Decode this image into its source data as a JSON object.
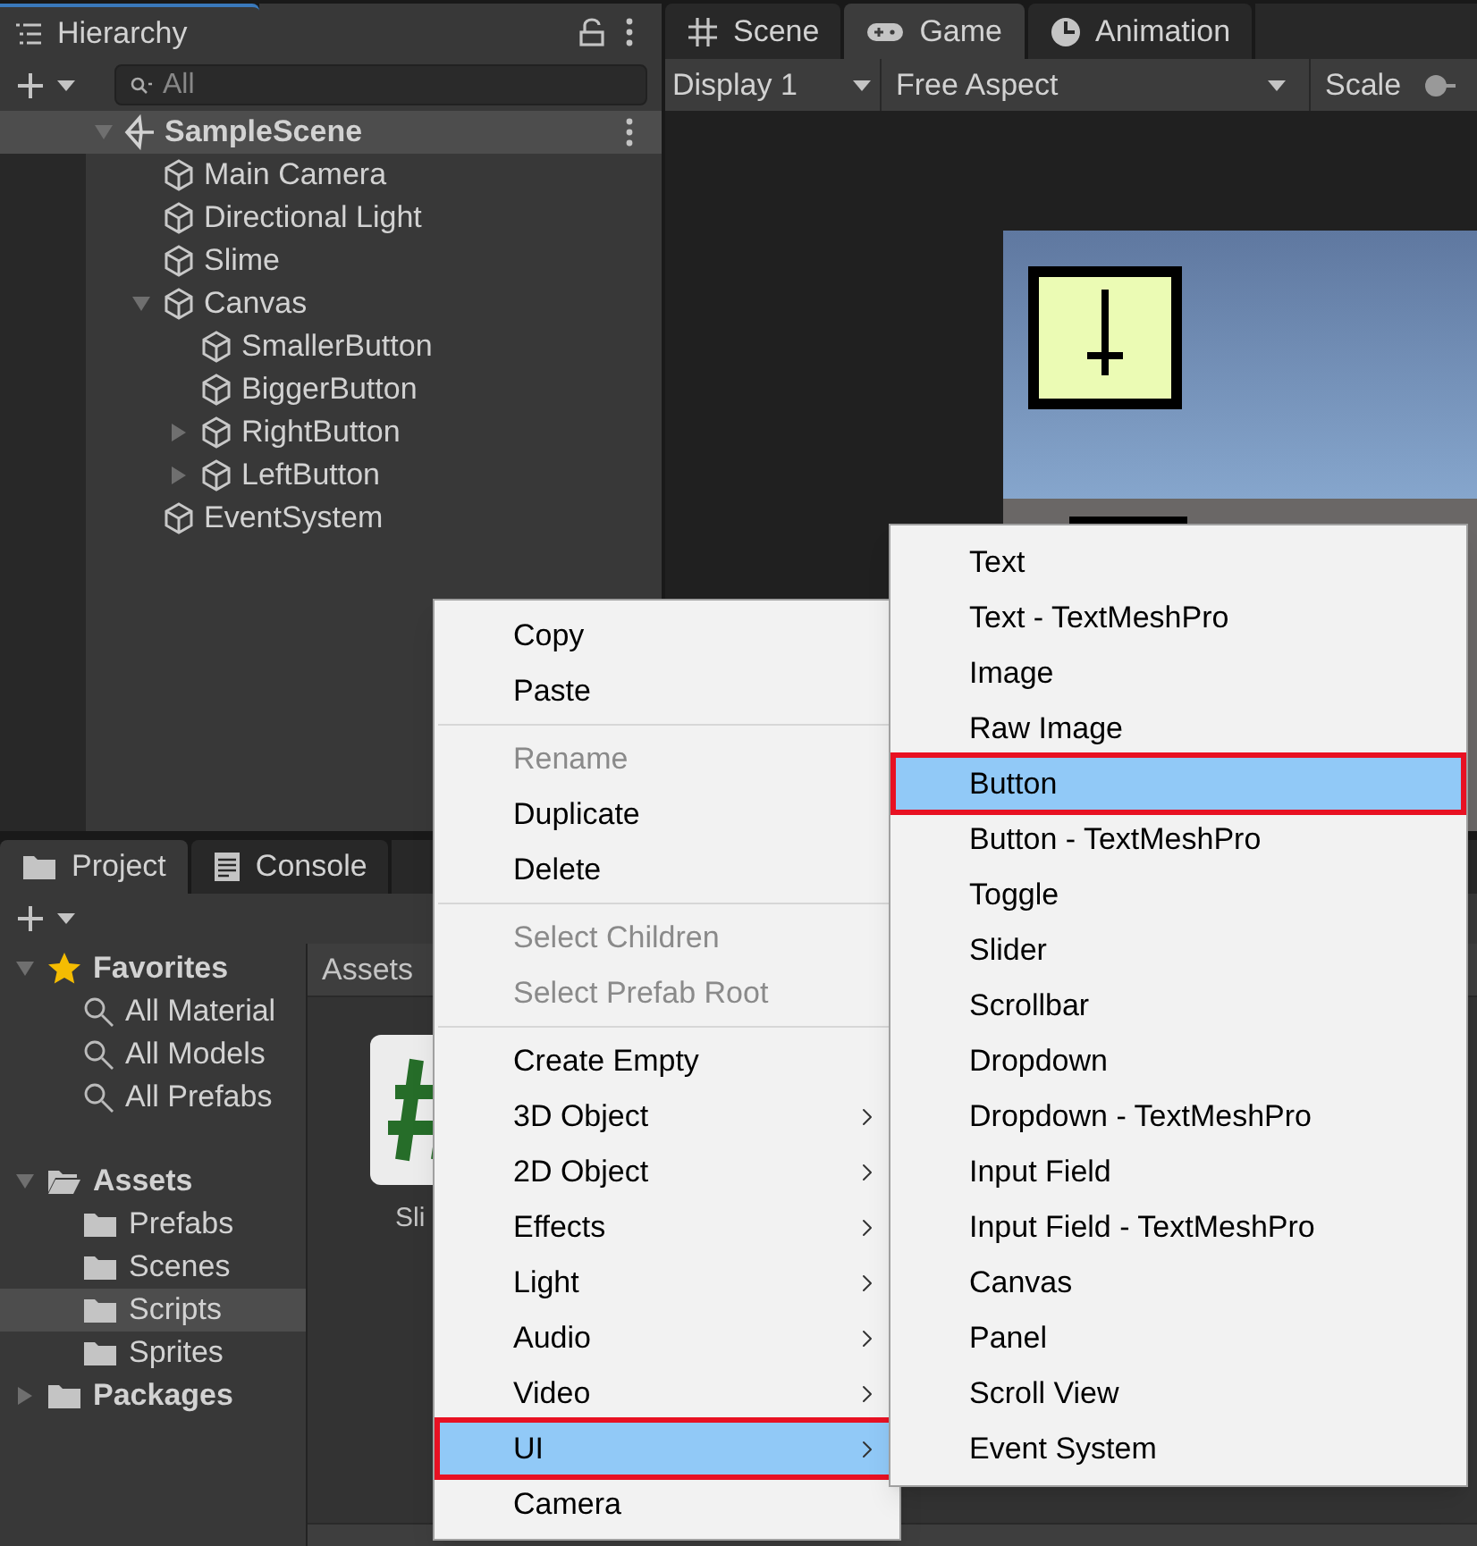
{
  "hierarchy": {
    "tab": "Hierarchy",
    "search": {
      "placeholder": "All"
    },
    "scene": {
      "name": "SampleScene",
      "expanded": true,
      "children": [
        {
          "name": "Main Camera"
        },
        {
          "name": "Directional Light"
        },
        {
          "name": "Slime"
        },
        {
          "name": "Canvas",
          "expanded": true,
          "children": [
            {
              "name": "SmallerButton"
            },
            {
              "name": "BiggerButton"
            },
            {
              "name": "RightButton",
              "expanded": false
            },
            {
              "name": "LeftButton",
              "expanded": false
            }
          ]
        },
        {
          "name": "EventSystem"
        }
      ]
    }
  },
  "view_tabs": [
    {
      "label": "Scene",
      "kind": "grid",
      "selected": false
    },
    {
      "label": "Game",
      "kind": "gamepad",
      "selected": true
    },
    {
      "label": "Animation",
      "kind": "clock",
      "selected": false
    }
  ],
  "game_toolbar": {
    "display": "Display 1",
    "aspect": "Free Aspect",
    "scale": "Scale"
  },
  "project": {
    "tabs": [
      {
        "label": "Project",
        "kind": "folder",
        "selected": true
      },
      {
        "label": "Console",
        "kind": "console",
        "selected": false
      }
    ],
    "tree": [
      {
        "label": "Favorites",
        "kind": "star",
        "expanded": true,
        "children": [
          {
            "label": "All Material",
            "kind": "search",
            "selected": false
          },
          {
            "label": "All Models",
            "kind": "search",
            "selected": false
          },
          {
            "label": "All Prefabs",
            "kind": "search",
            "selected": false
          }
        ]
      },
      {
        "label": "Assets",
        "kind": "folder",
        "expanded": true,
        "children": [
          {
            "label": "Prefabs",
            "kind": "folder",
            "selected": false
          },
          {
            "label": "Scenes",
            "kind": "folder",
            "selected": false
          },
          {
            "label": "Scripts",
            "kind": "folder",
            "selected": true
          },
          {
            "label": "Sprites",
            "kind": "folder",
            "selected": false
          }
        ]
      },
      {
        "label": "Packages",
        "kind": "folder",
        "expanded": false
      }
    ],
    "breadcrumb": "Assets",
    "assets": [
      {
        "name": "Sli"
      }
    ]
  },
  "context_menu": {
    "groups": [
      [
        {
          "label": "Copy",
          "disabled": false
        },
        {
          "label": "Paste",
          "disabled": false
        }
      ],
      [
        {
          "label": "Rename",
          "disabled": true
        },
        {
          "label": "Duplicate",
          "disabled": false
        },
        {
          "label": "Delete",
          "disabled": false
        }
      ],
      [
        {
          "label": "Select Children",
          "disabled": true
        },
        {
          "label": "Select Prefab Root",
          "disabled": true
        }
      ],
      [
        {
          "label": "Create Empty",
          "disabled": false,
          "submenu": false,
          "selected": false,
          "outlined": false
        },
        {
          "label": "3D Object",
          "disabled": false,
          "submenu": true,
          "selected": false,
          "outlined": false
        },
        {
          "label": "2D Object",
          "disabled": false,
          "submenu": true,
          "selected": false,
          "outlined": false
        },
        {
          "label": "Effects",
          "disabled": false,
          "submenu": true,
          "selected": false,
          "outlined": false
        },
        {
          "label": "Light",
          "disabled": false,
          "submenu": true,
          "selected": false,
          "outlined": false
        },
        {
          "label": "Audio",
          "disabled": false,
          "submenu": true,
          "selected": false,
          "outlined": false
        },
        {
          "label": "Video",
          "disabled": false,
          "submenu": true,
          "selected": false,
          "outlined": false
        },
        {
          "label": "UI",
          "disabled": false,
          "submenu": true,
          "selected": true,
          "outlined": true
        },
        {
          "label": "Camera",
          "disabled": false,
          "submenu": false,
          "selected": false,
          "outlined": false
        }
      ]
    ]
  },
  "submenu": {
    "items": [
      {
        "label": "Text",
        "selected": false,
        "outlined": false
      },
      {
        "label": "Text - TextMeshPro",
        "selected": false,
        "outlined": false
      },
      {
        "label": "Image",
        "selected": false,
        "outlined": false
      },
      {
        "label": "Raw Image",
        "selected": false,
        "outlined": false
      },
      {
        "label": "Button",
        "selected": true,
        "outlined": true
      },
      {
        "label": "Button - TextMeshPro",
        "selected": false,
        "outlined": false
      },
      {
        "label": "Toggle",
        "selected": false,
        "outlined": false
      },
      {
        "label": "Slider",
        "selected": false,
        "outlined": false
      },
      {
        "label": "Scrollbar",
        "selected": false,
        "outlined": false
      },
      {
        "label": "Dropdown",
        "selected": false,
        "outlined": false
      },
      {
        "label": "Dropdown - TextMeshPro",
        "selected": false,
        "outlined": false
      },
      {
        "label": "Input Field",
        "selected": false,
        "outlined": false
      },
      {
        "label": "Input Field - TextMeshPro",
        "selected": false,
        "outlined": false
      },
      {
        "label": "Canvas",
        "selected": false,
        "outlined": false
      },
      {
        "label": "Panel",
        "selected": false,
        "outlined": false
      },
      {
        "label": "Scroll View",
        "selected": false,
        "outlined": false
      },
      {
        "label": "Event System",
        "selected": false,
        "outlined": false
      }
    ]
  }
}
